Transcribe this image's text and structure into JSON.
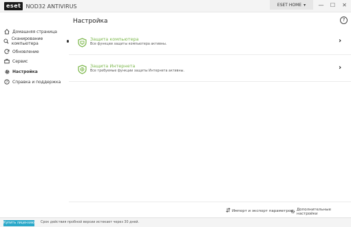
{
  "app": {
    "logo_text": "eset",
    "product_name": "NOD32 ANTIVIRUS",
    "account_label": "ESET HOME",
    "window_buttons": [
      "—",
      "☐",
      "✕"
    ]
  },
  "sidebar": {
    "items": [
      {
        "label": "Домашняя страница",
        "icon": "home-icon"
      },
      {
        "label": "Сканирование компьютера",
        "icon": "scan-icon",
        "dot": true
      },
      {
        "label": "Обновление",
        "icon": "update-icon"
      },
      {
        "label": "Сервис",
        "icon": "tools-icon"
      },
      {
        "label": "Настройка",
        "icon": "gear-icon",
        "active": true
      },
      {
        "label": "Справка и поддержка",
        "icon": "help-icon"
      }
    ]
  },
  "main": {
    "title": "Настройка",
    "help_glyph": "?",
    "cards": [
      {
        "title": "Защита компьютера",
        "desc": "Все функции защиты компьютера активны.",
        "icon": "computer-shield-icon"
      },
      {
        "title": "Защита Интернета",
        "desc": "Все требуемые функции защиты Интернета активны.",
        "icon": "globe-shield-icon"
      }
    ]
  },
  "footer": {
    "import_export": "Импорт и экспорт параметров",
    "advanced": "Дополнительные настройки"
  },
  "status": {
    "buy_label": "Купить лицензию",
    "trial_text": "Срок действия пробной версии истекает через 30 дней."
  },
  "colors": {
    "accent_green": "#7ab648",
    "buy_blue": "#2aa8c9"
  }
}
